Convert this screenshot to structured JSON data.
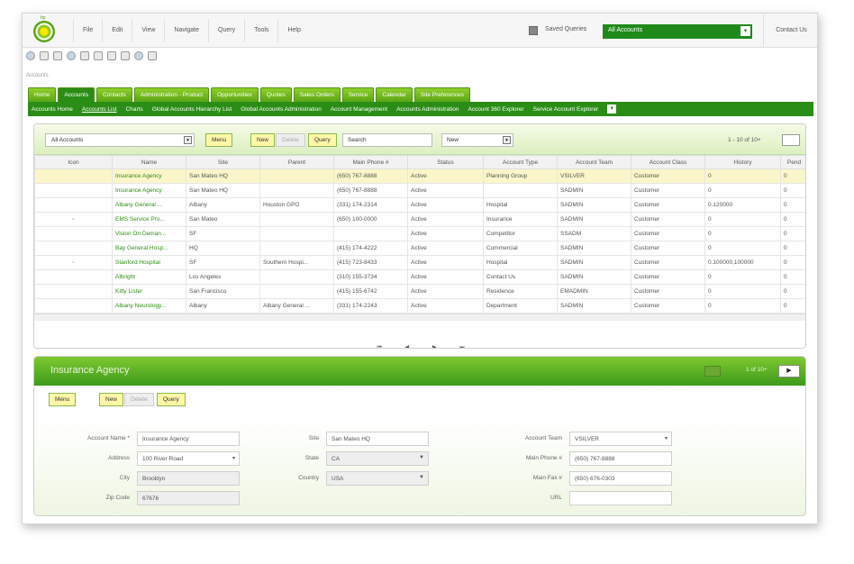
{
  "app": {
    "logo_text": "bp"
  },
  "menu": [
    "File",
    "Edit",
    "View",
    "Navigate",
    "Query",
    "Tools",
    "Help"
  ],
  "saved_queries": {
    "label": "Saved Queries",
    "value": "All Accounts",
    "dropdown_glyph": "▾"
  },
  "contact_us": "Contact Us",
  "breadcrumb": "Accounts",
  "tabs": [
    "Home",
    "Accounts",
    "Contacts",
    "Administration - Product",
    "Opportunities",
    "Quotes",
    "Sales Orders",
    "Service",
    "Calendar",
    "Site Preferences"
  ],
  "active_tab": 1,
  "subtabs": [
    "Accounts Home",
    "Accounts List",
    "Charts",
    "Global Accounts Hierarchy List",
    "Global Accounts Administration",
    "Account Management",
    "Accounts Administration",
    "Account 360 Explorer",
    "Service Account Explorer"
  ],
  "list": {
    "filter_value": "All Accounts",
    "menu_btn": "Menu",
    "new_btn": "New",
    "delete_btn": "Delete",
    "query_btn": "Query",
    "query_input": "Search",
    "new_select": "New",
    "count": "1 - 10 of 10+",
    "columns": [
      "Icon",
      "Name",
      "Site",
      "Parent",
      "Main Phone #",
      "Status",
      "Account Type",
      "Account Team",
      "Account Class",
      "History",
      "Pend"
    ],
    "rows": [
      [
        "",
        "Insurance Agency",
        "San Mateo HQ",
        "",
        "(650) 767-8888",
        "Active",
        "Planning Group",
        "VSILVER",
        "Customer",
        "0",
        "0"
      ],
      [
        "",
        "Insurance Agency",
        "San Mateo HQ",
        "",
        "(650) 767-8888",
        "Active",
        "",
        "SADMIN",
        "Customer",
        "0",
        "0"
      ],
      [
        "",
        "Albany General ...",
        "Albany",
        "Houston GPO",
        "(331) 174-2314",
        "Active",
        "Hospital",
        "SADMIN",
        "Customer",
        "0.120000",
        "0"
      ],
      [
        "◦",
        "EMS Service Pro...",
        "San Mateo",
        "",
        "(650) 100-0000",
        "Active",
        "Insurance",
        "SADMIN",
        "Customer",
        "0",
        "0"
      ],
      [
        "",
        "Vision On Deman...",
        "SF",
        "",
        "",
        "Active",
        "Competitor",
        "SSADM",
        "Customer",
        "0",
        "0"
      ],
      [
        "",
        "Bay General Hosp...",
        "HQ",
        "",
        "(415) 174-4222",
        "Active",
        "Commercial",
        "SADMIN",
        "Customer",
        "0",
        "0"
      ],
      [
        "◦",
        "Stanford Hospital",
        "SF",
        "Southern Hospi...",
        "(415) 723-8433",
        "Active",
        "Hospital",
        "SADMIN",
        "Customer",
        "0.100000,100000",
        "0"
      ],
      [
        "",
        "Albright",
        "Los Angeles",
        "",
        "(310) 155-3734",
        "Active",
        "Contact Us",
        "SADMIN",
        "Customer",
        "0",
        "0"
      ],
      [
        "",
        "Kitty Lister",
        "San Francisco",
        "",
        "(415) 155-6742",
        "Active",
        "Residence",
        "EMADMIN",
        "Customer",
        "0",
        "0"
      ],
      [
        "",
        "Albany Neurology...",
        "Albany",
        "Albany General ...",
        "(331) 174-2243",
        "Active",
        "Department",
        "SADMIN",
        "Customer",
        "0",
        "0"
      ]
    ],
    "selected_row": 0,
    "pager": [
      "⏮",
      "◀",
      "▶",
      "⏭"
    ]
  },
  "form": {
    "title": "Insurance Agency",
    "count": "1 of 10+",
    "next_glyph": "▶",
    "menu_btn": "Menu",
    "new_btn": "New",
    "delete_btn": "Delete",
    "query_btn": "Query",
    "fields": {
      "account_name": {
        "label": "Account Name *",
        "value": "Insurance Agency"
      },
      "address": {
        "label": "Address",
        "value": "100 River Road"
      },
      "city": {
        "label": "City",
        "value": "Brooklyn"
      },
      "zip": {
        "label": "Zip Code",
        "value": "67676"
      },
      "site": {
        "label": "Site",
        "value": "San Mateo HQ"
      },
      "state": {
        "label": "State",
        "value": "CA"
      },
      "country": {
        "label": "Country",
        "value": "USA"
      },
      "account_team": {
        "label": "Account Team",
        "value": "VSILVER"
      },
      "main_phone": {
        "label": "Main Phone #",
        "value": "(650) 767-8888"
      },
      "main_fax": {
        "label": "Main Fax #",
        "value": "(650) 676-0303"
      },
      "url": {
        "label": "URL",
        "value": ""
      }
    }
  }
}
